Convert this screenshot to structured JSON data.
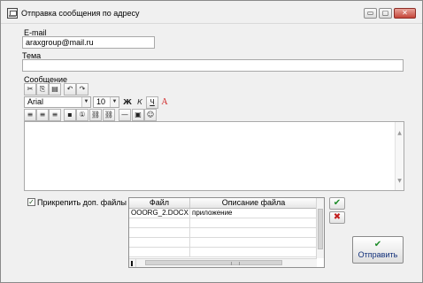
{
  "window": {
    "title": "Отправка сообщения по адресу",
    "icon": "app-envelope-icon",
    "controls": {
      "minimize": "▭",
      "maximize": "▢",
      "close": "✕"
    }
  },
  "form": {
    "email_label": "E-mail",
    "email_value": "araxgroup@mail.ru",
    "subject_label": "Тема",
    "subject_value": "",
    "message_label": "Сообщение",
    "message_value": ""
  },
  "toolbar": {
    "row1": [
      {
        "name": "cut-icon",
        "glyph": "✂"
      },
      {
        "name": "copy-icon",
        "glyph": "⎘"
      },
      {
        "name": "paste-icon",
        "glyph": "▤"
      },
      {
        "name": "undo-icon",
        "glyph": "↶"
      },
      {
        "name": "redo-icon",
        "glyph": "↷"
      }
    ],
    "font_name": "Arial",
    "font_size": "10",
    "bold": "Ж",
    "italic": "К",
    "underline": "Ч",
    "font_color": "A",
    "row3": [
      {
        "name": "align-left-icon",
        "glyph": "≡"
      },
      {
        "name": "align-center-icon",
        "glyph": "≡"
      },
      {
        "name": "align-right-icon",
        "glyph": "≡"
      },
      {
        "name": "bullet-icon",
        "glyph": "▪"
      },
      {
        "name": "numbering-icon",
        "glyph": "①"
      },
      {
        "name": "link-icon",
        "glyph": "⛓"
      },
      {
        "name": "unlink-icon",
        "glyph": "⛓"
      },
      {
        "name": "horizontal-line-icon",
        "glyph": "—"
      },
      {
        "name": "image-icon",
        "glyph": "▣"
      },
      {
        "name": "smiley-icon",
        "glyph": "☺"
      }
    ]
  },
  "attachments": {
    "checkbox_label": "Прикрепить доп. файлы",
    "checked": true,
    "columns": [
      "Файл",
      "Описание файла"
    ],
    "rows": [
      [
        "OOORG_2.DOCX",
        "приложение"
      ],
      [
        "",
        ""
      ],
      [
        "",
        ""
      ],
      [
        "",
        ""
      ],
      [
        "",
        ""
      ]
    ],
    "add_glyph": "✔",
    "remove_glyph": "✖"
  },
  "send_button": {
    "icon": "✔",
    "label": "Отправить"
  },
  "colors": {
    "accent_green": "#1f8c2a",
    "delete_red": "#c21f1f",
    "font_color_red": "#d02020",
    "window_bg": "#f0f0f0"
  }
}
